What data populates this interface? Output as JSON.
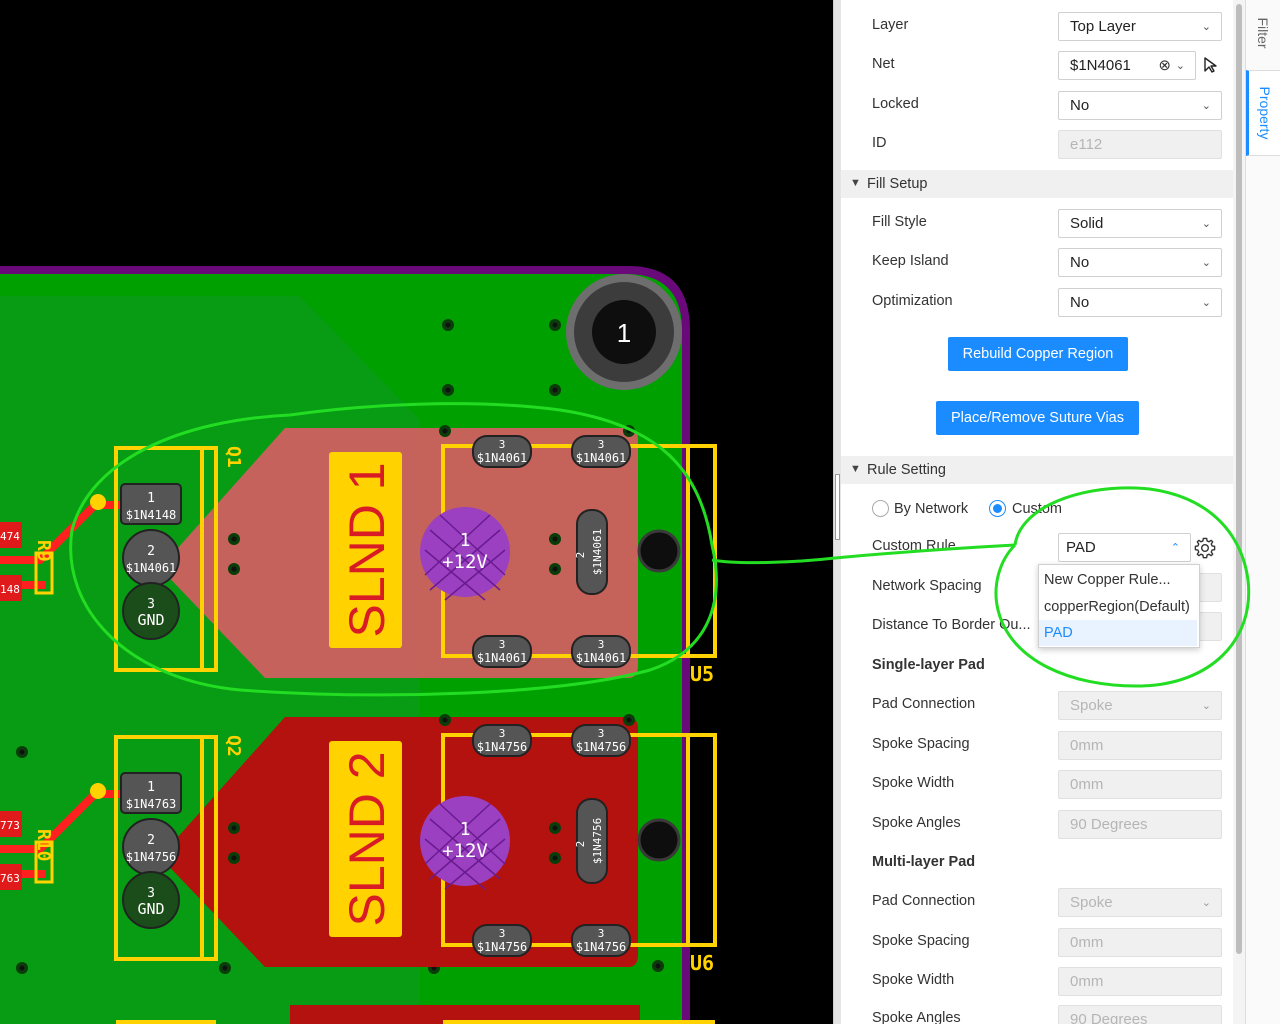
{
  "canvas": {
    "mounting_hole_label": "1",
    "parts": [
      {
        "ref": "Q1",
        "resistor_ref": "R9",
        "pins": [
          {
            "num": "1",
            "net": "$1N4148"
          },
          {
            "num": "2",
            "net": "$1N4061"
          },
          {
            "num": "3",
            "net": "GND"
          }
        ],
        "left_net_labels": [
          "474",
          "148"
        ],
        "fill": "#e8586a",
        "solenoid": {
          "label": "SLND 1",
          "center_num": "1",
          "center_net": "+12V",
          "pin2_num": "2",
          "pin2_net": "$1N4061",
          "pin3_num": "3",
          "pin3_net": "$1N4061"
        },
        "connector_ref": "U5"
      },
      {
        "ref": "Q2",
        "resistor_ref": "R10",
        "pins": [
          {
            "num": "1",
            "net": "$1N4763"
          },
          {
            "num": "2",
            "net": "$1N4756"
          },
          {
            "num": "3",
            "net": "GND"
          }
        ],
        "left_net_labels": [
          "773",
          "763"
        ],
        "fill": "#b4120f",
        "solenoid": {
          "label": "SLND 2",
          "center_num": "1",
          "center_net": "+12V",
          "pin2_num": "2",
          "pin2_net": "$1N4756",
          "pin3_num": "3",
          "pin3_net": "$1N4756"
        },
        "connector_ref": "U6"
      }
    ]
  },
  "properties": {
    "top_rows": [
      {
        "label": "Layer",
        "value": "Top Layer",
        "control": "select"
      },
      {
        "label": "Net",
        "value": "$1N4061",
        "control": "net-select"
      },
      {
        "label": "Locked",
        "value": "No",
        "control": "select"
      },
      {
        "label": "ID",
        "value": "e112",
        "control": "readonly"
      }
    ],
    "fill_setup": {
      "title": "Fill Setup",
      "rows": [
        {
          "label": "Fill Style",
          "value": "Solid"
        },
        {
          "label": "Keep Island",
          "value": "No"
        },
        {
          "label": "Optimization",
          "value": "No"
        }
      ],
      "rebuild_button": "Rebuild Copper Region",
      "suture_button": "Place/Remove Suture Vias"
    },
    "rule_setting": {
      "title": "Rule Setting",
      "by_network_label": "By Network",
      "custom_label": "Custom",
      "custom_rule_label": "Custom Rule",
      "custom_rule_value": "PAD",
      "network_spacing_label": "Network Spacing",
      "distance_border_label": "Distance To Border Ou...",
      "dropdown_options": [
        "New Copper Rule...",
        "copperRegion(Default)",
        "PAD"
      ],
      "single_layer_pad": {
        "title": "Single-layer Pad",
        "rows": [
          {
            "label": "Pad Connection",
            "value": "Spoke"
          },
          {
            "label": "Spoke Spacing",
            "value": "0mm"
          },
          {
            "label": "Spoke Width",
            "value": "0mm"
          },
          {
            "label": "Spoke Angles",
            "value": "90 Degrees"
          }
        ]
      },
      "multi_layer_pad": {
        "title": "Multi-layer Pad",
        "rows": [
          {
            "label": "Pad Connection",
            "value": "Spoke"
          },
          {
            "label": "Spoke Spacing",
            "value": "0mm"
          },
          {
            "label": "Spoke Width",
            "value": "0mm"
          },
          {
            "label": "Spoke Angles",
            "value": "90 Degrees"
          }
        ]
      }
    }
  },
  "side_tabs": {
    "filter": "Filter",
    "property": "Property"
  },
  "colors": {
    "accent": "#1a8cff",
    "board": "#00a000",
    "outline": "#6a0a7a",
    "silkscreen": "#ffd200",
    "annotation": "#22dd22"
  }
}
